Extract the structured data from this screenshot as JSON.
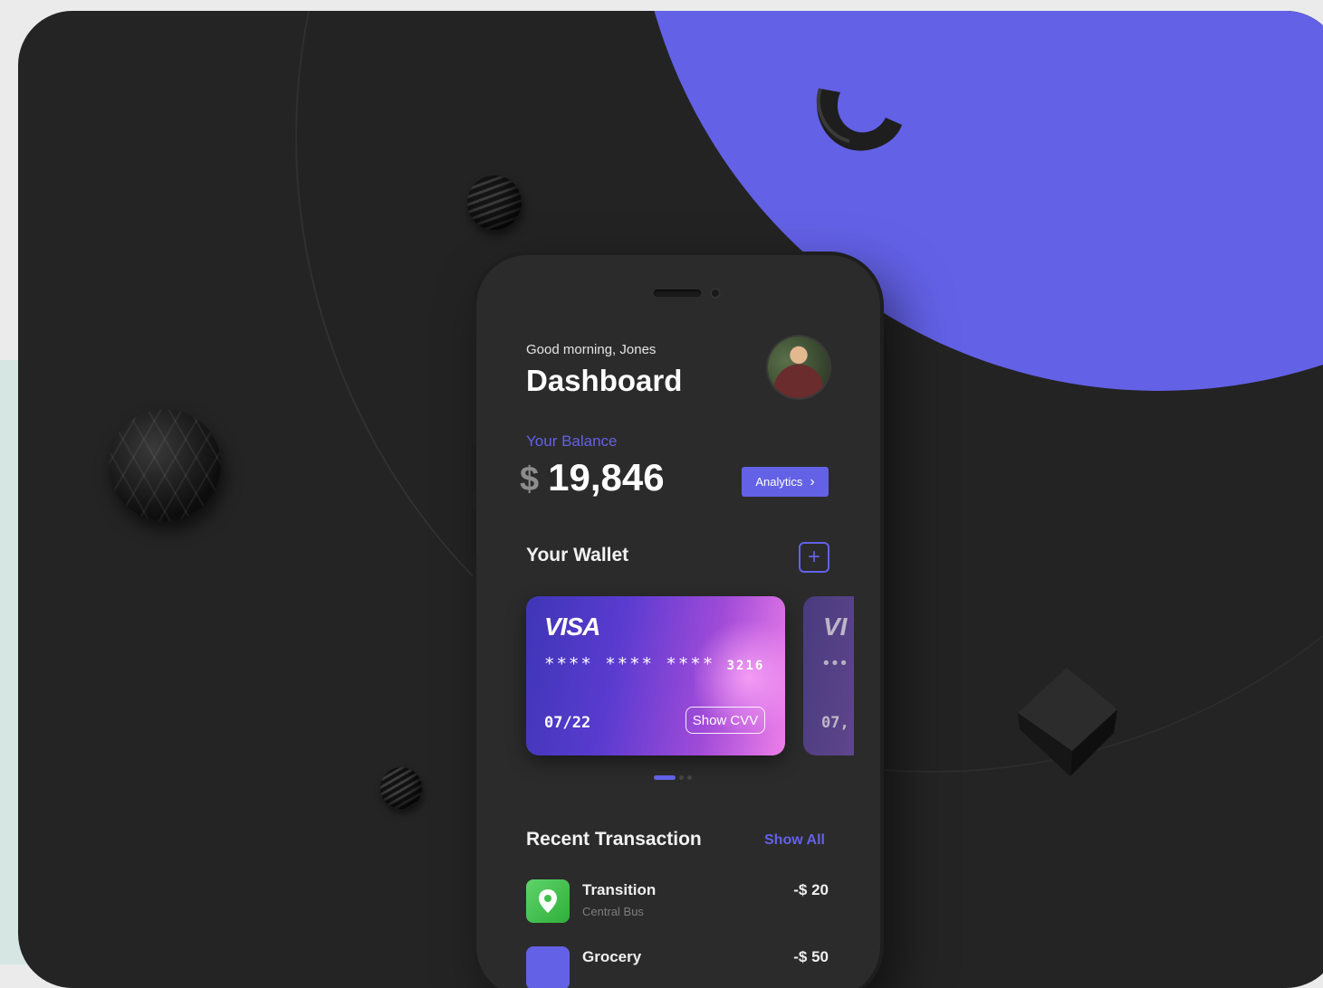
{
  "colors": {
    "accent": "#6361e6",
    "canvas": "#242424",
    "phone": "#2b2b2b",
    "transit_icon": "#3ec14b"
  },
  "header": {
    "greeting": "Good morning, Jones",
    "title": "Dashboard",
    "avatar_icon": "user-avatar"
  },
  "balance": {
    "label": "Your Balance",
    "currency": "$",
    "amount": "19,846",
    "analytics_label": "Analytics",
    "analytics_icon": "chevron-right-icon"
  },
  "wallet": {
    "title": "Your Wallet",
    "add_icon": "plus-icon",
    "cards": [
      {
        "brand": "VISA",
        "number_masked": "**** **** ****",
        "last4": "3216",
        "expiry": "07/22",
        "cvv_label": "Show CVV"
      },
      {
        "brand": "VI",
        "number_masked": "•••",
        "expiry": "07,"
      }
    ],
    "pager": {
      "total": 3,
      "active": 0
    }
  },
  "transactions": {
    "title": "Recent Transaction",
    "show_all_label": "Show All",
    "items": [
      {
        "name": "Transition",
        "subtitle": "Central Bus",
        "amount": "-$ 20",
        "icon": "map-pin-icon"
      },
      {
        "name": "Grocery",
        "subtitle": "",
        "amount": "-$ 50",
        "icon": "grocery-icon"
      }
    ]
  }
}
